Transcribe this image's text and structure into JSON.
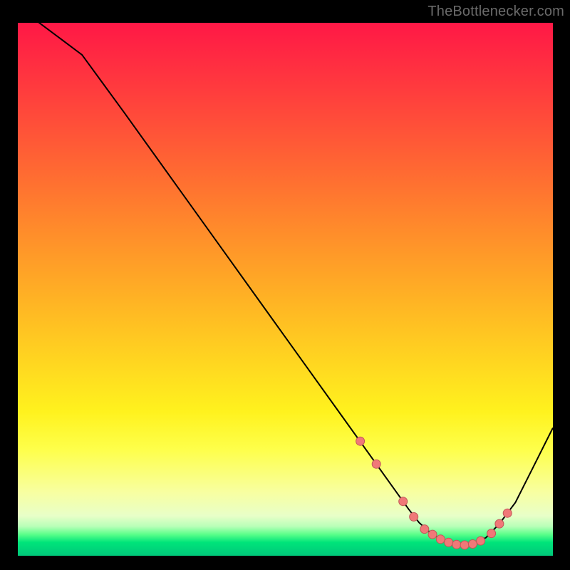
{
  "attribution": "TheBottlenecker.com",
  "colors": {
    "curve": "#000000",
    "marker_fill": "#f07878",
    "marker_stroke": "#c05858"
  },
  "chart_data": {
    "type": "line",
    "title": "",
    "xlabel": "",
    "ylabel": "",
    "xlim": [
      0,
      100
    ],
    "ylim": [
      0,
      100
    ],
    "notes": "Heat gradient background runs red (top, y≈100) through orange/yellow to a thin green band at the very bottom (y≈0). Curve is a single black line; salmon dots mark sample points near the minimum.",
    "series": [
      {
        "name": "bottleneck-curve",
        "x": [
          0,
          4,
          8,
          12,
          20,
          30,
          40,
          50,
          60,
          65,
          70,
          73,
          75,
          77.5,
          80,
          82.5,
          85,
          87.5,
          90,
          93,
          96,
          100
        ],
        "values": [
          103,
          100,
          97,
          94,
          83,
          69,
          55,
          41,
          27,
          20,
          13,
          8.8,
          6.2,
          4.0,
          2.6,
          2.0,
          2.2,
          3.4,
          6.0,
          10,
          16,
          24
        ]
      }
    ],
    "markers": {
      "series_name": "bottleneck-curve",
      "x": [
        64,
        67,
        72,
        74,
        76,
        77.5,
        79,
        80.5,
        82,
        83.5,
        85,
        86.5,
        88.5,
        90,
        91.5
      ],
      "values": [
        21.5,
        17.2,
        10.2,
        7.3,
        5.0,
        4.0,
        3.1,
        2.5,
        2.1,
        2.0,
        2.2,
        2.8,
        4.2,
        6.0,
        8.0
      ],
      "radius": 6
    }
  }
}
